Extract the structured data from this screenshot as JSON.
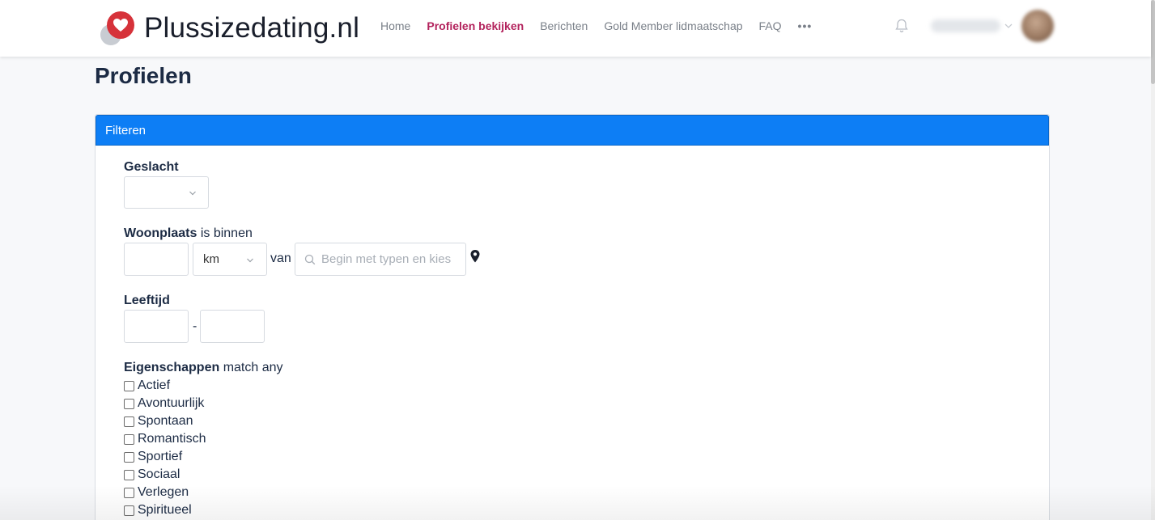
{
  "header": {
    "logo_text": "Plussizedating.nl",
    "nav": [
      {
        "label": "Home",
        "active": false
      },
      {
        "label": "Profielen bekijken",
        "active": true
      },
      {
        "label": "Berichten",
        "active": false
      },
      {
        "label": "Gold Member lidmaatschap",
        "active": false
      },
      {
        "label": "FAQ",
        "active": false
      }
    ],
    "more_label": "•••",
    "icons": {
      "notifications": "bell-icon",
      "user_menu": "chevron-down-icon"
    }
  },
  "page": {
    "title": "Profielen"
  },
  "filter": {
    "header": "Filteren",
    "gender": {
      "label": "Geslacht",
      "value": ""
    },
    "location": {
      "label_bold": "Woonplaats",
      "label_rest": " is binnen",
      "distance_value": "",
      "unit": "km",
      "van_label": "van",
      "search_placeholder": "Begin met typen en kies",
      "pin_icon": "map-pin-icon"
    },
    "age": {
      "label": "Leeftijd",
      "min": "",
      "separator": "-",
      "max": ""
    },
    "traits": {
      "label_bold": "Eigenschappen",
      "label_rest": " match any",
      "options": [
        "Actief",
        "Avontuurlijk",
        "Spontaan",
        "Romantisch",
        "Sportief",
        "Sociaal",
        "Verlegen",
        "Spiritueel"
      ]
    }
  },
  "colors": {
    "accent_nav": "#b3235d",
    "filter_header": "#0d7ef5",
    "logo_heart": "#d6323a",
    "title": "#1c2b44"
  }
}
